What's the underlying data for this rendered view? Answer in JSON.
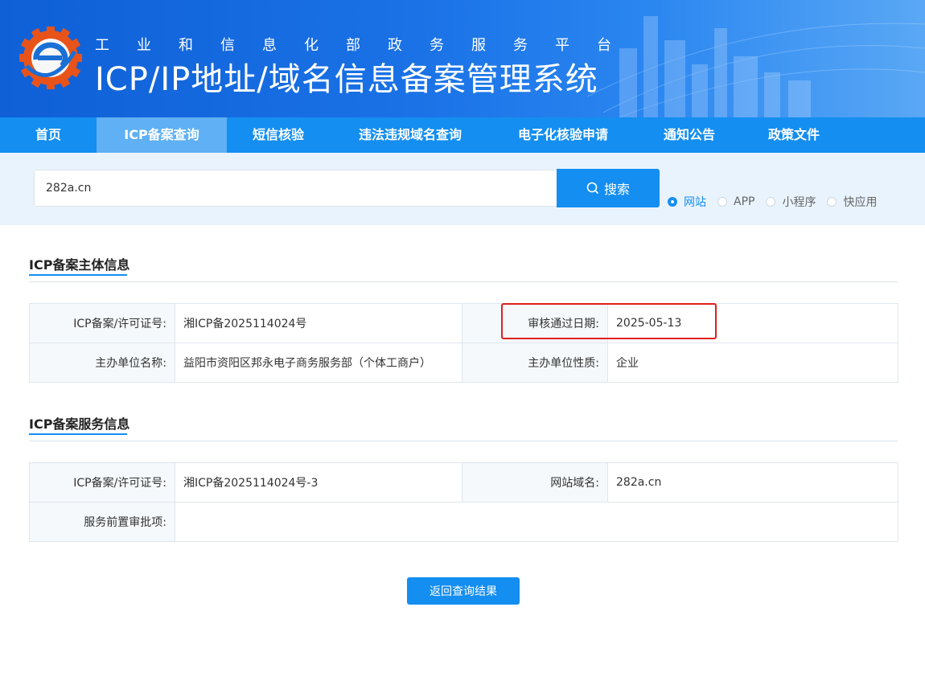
{
  "header": {
    "subtitle": "工业和信息化部政务服务平台",
    "title": "ICP/IP地址/域名信息备案管理系统"
  },
  "nav": {
    "items": [
      {
        "label": "首页"
      },
      {
        "label": "ICP备案查询",
        "active": true
      },
      {
        "label": "短信核验"
      },
      {
        "label": "违法违规域名查询"
      },
      {
        "label": "电子化核验申请"
      },
      {
        "label": "通知公告"
      },
      {
        "label": "政策文件"
      }
    ]
  },
  "search": {
    "value": "282a.cn",
    "button_label": "搜索",
    "options": [
      {
        "label": "网站",
        "checked": true
      },
      {
        "label": "APP",
        "checked": false
      },
      {
        "label": "小程序",
        "checked": false
      },
      {
        "label": "快应用",
        "checked": false
      }
    ]
  },
  "subject_info": {
    "title": "ICP备案主体信息",
    "license_label": "ICP备案/许可证号:",
    "license_value": "湘ICP备2025114024号",
    "approve_date_label": "审核通过日期:",
    "approve_date_value": "2025-05-13",
    "org_name_label": "主办单位名称:",
    "org_name_value": "益阳市资阳区邦永电子商务服务部（个体工商户）",
    "org_type_label": "主办单位性质:",
    "org_type_value": "企业"
  },
  "service_info": {
    "title": "ICP备案服务信息",
    "license_label": "ICP备案/许可证号:",
    "license_value": "湘ICP备2025114024号-3",
    "domain_label": "网站域名:",
    "domain_value": "282a.cn",
    "approval_label": "服务前置审批项:",
    "approval_value": ""
  },
  "back_button_label": "返回查询结果",
  "colors": {
    "primary": "#148ef0",
    "nav_active": "#5fb0f4",
    "highlight_box": "#e0201f"
  }
}
